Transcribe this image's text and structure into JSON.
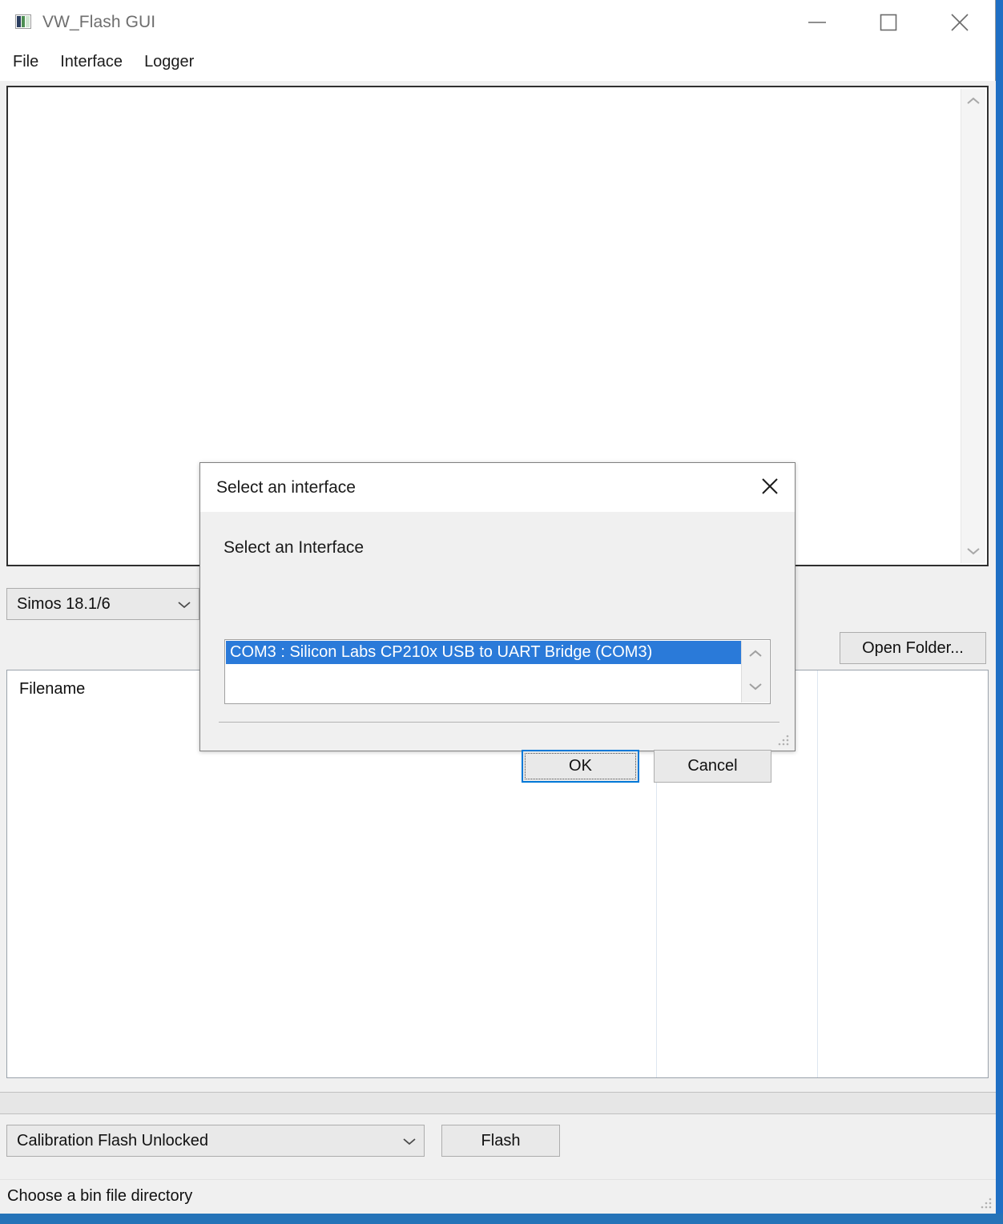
{
  "window": {
    "title": "VW_Flash GUI",
    "icon": "app-window-icon",
    "controls": {
      "minimize": "minimize-icon",
      "maximize": "maximize-icon",
      "close": "close-icon"
    }
  },
  "menu": {
    "items": [
      {
        "label": "File"
      },
      {
        "label": "Interface"
      },
      {
        "label": "Logger"
      }
    ]
  },
  "log_area": {
    "text": "",
    "scrollbar": {
      "up": "chevron-up-icon",
      "down": "chevron-down-icon"
    }
  },
  "config_row": {
    "ecu_combo": {
      "value": "Simos 18.1/6",
      "chevron": "chevron-down-icon"
    },
    "open_folder_button": "Open Folder..."
  },
  "file_table": {
    "columns": [
      {
        "header": "Filename"
      },
      {
        "header": ""
      },
      {
        "header": ""
      }
    ],
    "rows": []
  },
  "progress": {
    "percent": 0
  },
  "flash_row": {
    "mode_combo": {
      "value": "Calibration Flash Unlocked",
      "chevron": "chevron-down-icon"
    },
    "flash_button": "Flash"
  },
  "status_bar": {
    "message": "Choose a bin file directory",
    "grip": "resize-grip-icon"
  },
  "dialog": {
    "title": "Select an interface",
    "close": "close-icon",
    "label": "Select an Interface",
    "list": {
      "items": [
        {
          "label": "COM3 : Silicon Labs CP210x USB to UART Bridge (COM3)",
          "selected": true
        }
      ],
      "scrollbar": {
        "up": "chevron-up-icon",
        "down": "chevron-down-icon"
      }
    },
    "ok_button": "OK",
    "cancel_button": "Cancel",
    "grip": "resize-grip-icon"
  },
  "colors": {
    "selection_blue": "#2a7ad9",
    "focus_blue": "#0078d7",
    "window_face": "#f0f0f0",
    "taskbar_blue": "#2573b8"
  }
}
